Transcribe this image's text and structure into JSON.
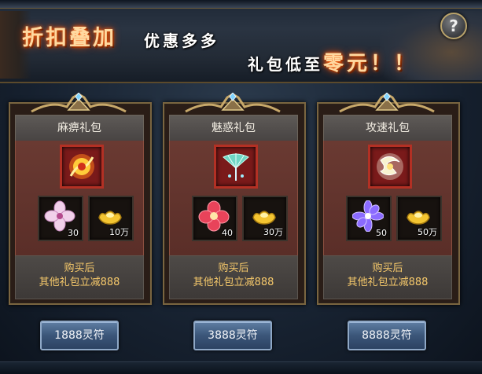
{
  "banner": {
    "slogan_bold": "折扣叠加",
    "slogan_mid": "优惠多多",
    "slogan_tail_prefix": "礼包低至",
    "slogan_tail_highlight": "零元",
    "slogan_tail_suffix": "！！",
    "help_label": "?"
  },
  "packs": [
    {
      "name": "麻痹礼包",
      "main_icon": "flame-flower-icon",
      "items": [
        {
          "icon": "pink-flower-icon",
          "qty": "30"
        },
        {
          "icon": "gold-ingot-icon",
          "qty": "10万"
        }
      ],
      "note_line1": "购买后",
      "note_line2": "其他礼包立减888",
      "price": "1888灵符"
    },
    {
      "name": "魅惑礼包",
      "main_icon": "jade-fan-icon",
      "items": [
        {
          "icon": "red-flower-icon",
          "qty": "40"
        },
        {
          "icon": "gold-ingot-icon",
          "qty": "30万"
        }
      ],
      "note_line1": "购买后",
      "note_line2": "其他礼包立减888",
      "price": "3888灵符"
    },
    {
      "name": "攻速礼包",
      "main_icon": "spirit-orb-icon",
      "items": [
        {
          "icon": "purple-flower-icon",
          "qty": "50"
        },
        {
          "icon": "gold-ingot-icon",
          "qty": "50万"
        }
      ],
      "note_line1": "购买后",
      "note_line2": "其他礼包立减888",
      "price": "8888灵符"
    }
  ],
  "colors": {
    "frame_gold": "#7a6540",
    "body_red": "#5a2e28",
    "note_gold": "#f6c96b",
    "button_blue": "#3b5679"
  }
}
